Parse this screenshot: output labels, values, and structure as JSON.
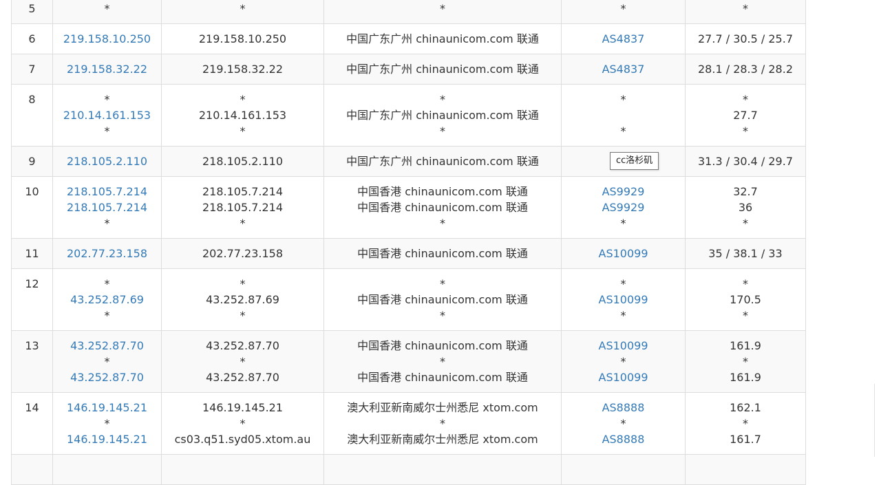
{
  "rows": [
    {
      "hop": "5",
      "ips": [
        "*"
      ],
      "hosts": [
        "*"
      ],
      "locations": [
        "*"
      ],
      "asns": [
        "*"
      ],
      "times": [
        "*"
      ],
      "ip_links": [
        false
      ],
      "asn_links": [
        false
      ]
    },
    {
      "hop": "6",
      "ips": [
        "219.158.10.250"
      ],
      "hosts": [
        "219.158.10.250"
      ],
      "locations": [
        "中国广东广州 chinaunicom.com 联通"
      ],
      "asns": [
        "AS4837"
      ],
      "times": [
        "27.7 / 30.5 / 25.7"
      ],
      "ip_links": [
        true
      ],
      "asn_links": [
        true
      ]
    },
    {
      "hop": "7",
      "ips": [
        "219.158.32.22"
      ],
      "hosts": [
        "219.158.32.22"
      ],
      "locations": [
        "中国广东广州 chinaunicom.com 联通"
      ],
      "asns": [
        "AS4837"
      ],
      "times": [
        "28.1 / 28.3 / 28.2"
      ],
      "ip_links": [
        true
      ],
      "asn_links": [
        true
      ]
    },
    {
      "hop": "8",
      "ips": [
        "*",
        "210.14.161.153",
        "*"
      ],
      "hosts": [
        "*",
        "210.14.161.153",
        "*"
      ],
      "locations": [
        "*",
        "中国广东广州 chinaunicom.com 联通",
        "*"
      ],
      "asns": [
        "*",
        "",
        "*"
      ],
      "times": [
        "*",
        "27.7",
        "*"
      ],
      "ip_links": [
        false,
        true,
        false
      ],
      "asn_links": [
        false,
        false,
        false
      ]
    },
    {
      "hop": "9",
      "ips": [
        "218.105.2.110"
      ],
      "hosts": [
        "218.105.2.110"
      ],
      "locations": [
        "中国广东广州 chinaunicom.com 联通"
      ],
      "asns": [
        "A"
      ],
      "times": [
        "31.3 / 30.4 / 29.7"
      ],
      "ip_links": [
        true
      ],
      "asn_links": [
        true
      ]
    },
    {
      "hop": "10",
      "ips": [
        "218.105.7.214",
        "218.105.7.214",
        "*"
      ],
      "hosts": [
        "218.105.7.214",
        "218.105.7.214",
        "*"
      ],
      "locations": [
        "中国香港 chinaunicom.com 联通",
        "中国香港 chinaunicom.com 联通",
        "*"
      ],
      "asns": [
        "AS9929",
        "AS9929",
        "*"
      ],
      "times": [
        "32.7",
        "36",
        "*"
      ],
      "ip_links": [
        true,
        true,
        false
      ],
      "asn_links": [
        true,
        true,
        false
      ]
    },
    {
      "hop": "11",
      "ips": [
        "202.77.23.158"
      ],
      "hosts": [
        "202.77.23.158"
      ],
      "locations": [
        "中国香港 chinaunicom.com 联通"
      ],
      "asns": [
        "AS10099"
      ],
      "times": [
        "35 / 38.1 / 33"
      ],
      "ip_links": [
        true
      ],
      "asn_links": [
        true
      ]
    },
    {
      "hop": "12",
      "ips": [
        "*",
        "43.252.87.69",
        "*"
      ],
      "hosts": [
        "*",
        "43.252.87.69",
        "*"
      ],
      "locations": [
        "*",
        "中国香港 chinaunicom.com 联通",
        "*"
      ],
      "asns": [
        "*",
        "AS10099",
        "*"
      ],
      "times": [
        "*",
        "170.5",
        "*"
      ],
      "ip_links": [
        false,
        true,
        false
      ],
      "asn_links": [
        false,
        true,
        false
      ]
    },
    {
      "hop": "13",
      "ips": [
        "43.252.87.70",
        "*",
        "43.252.87.70"
      ],
      "hosts": [
        "43.252.87.70",
        "*",
        "43.252.87.70"
      ],
      "locations": [
        "中国香港 chinaunicom.com 联通",
        "*",
        "中国香港 chinaunicom.com 联通"
      ],
      "asns": [
        "AS10099",
        "*",
        "AS10099"
      ],
      "times": [
        "161.9",
        "*",
        "161.9"
      ],
      "ip_links": [
        true,
        false,
        true
      ],
      "asn_links": [
        true,
        false,
        true
      ]
    },
    {
      "hop": "14",
      "ips": [
        "146.19.145.21",
        "*",
        "146.19.145.21"
      ],
      "hosts": [
        "146.19.145.21",
        "*",
        "cs03.q51.syd05.xtom.au"
      ],
      "locations": [
        "澳大利亚新南威尔士州悉尼 xtom.com",
        "*",
        "澳大利亚新南威尔士州悉尼 xtom.com"
      ],
      "asns": [
        "AS8888",
        "*",
        "AS8888"
      ],
      "times": [
        "162.1",
        "*",
        "161.7"
      ],
      "ip_links": [
        true,
        false,
        true
      ],
      "asn_links": [
        true,
        false,
        true
      ]
    },
    {
      "hop": "",
      "ips": [
        ""
      ],
      "hosts": [
        ""
      ],
      "locations": [
        ""
      ],
      "asns": [
        ""
      ],
      "times": [
        ""
      ],
      "ip_links": [
        false
      ],
      "asn_links": [
        false
      ]
    }
  ],
  "tooltip": {
    "text": "cc洛杉矶"
  },
  "colors": {
    "link": "#337ab7",
    "border": "#dddddd",
    "stripe": "#f9f9f9"
  }
}
